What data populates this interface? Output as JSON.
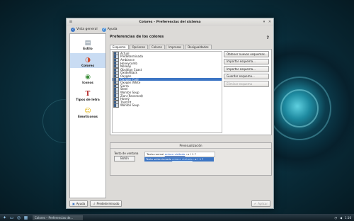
{
  "window": {
    "title": "Colores – Preferencias del sistema",
    "menu_icon": "☰",
    "min_icon": "▾",
    "close_icon": "✕"
  },
  "toolbar": {
    "overview_label": "Vista general",
    "help_label": "Ayuda"
  },
  "sidebar": {
    "items": [
      {
        "label": "Estilo",
        "icon": "style-icon",
        "glyph": "▤"
      },
      {
        "label": "Colores",
        "icon": "colors-icon",
        "glyph": "◑"
      },
      {
        "label": "Iconos",
        "icon": "icons-icon",
        "glyph": "◉"
      },
      {
        "label": "Tipos de letra",
        "icon": "fonts-icon",
        "glyph": "T"
      },
      {
        "label": "Emoticonos",
        "icon": "emoticons-icon",
        "glyph": "☺"
      }
    ]
  },
  "main": {
    "title": "Preferencias de los colores",
    "help_icon": "?",
    "tabs": [
      "Esquema",
      "Opciones",
      "Colores",
      "Impresos",
      "Desigualdades"
    ],
    "schemes": [
      "Actual",
      "Predeterminada",
      "Ambiance",
      "Honeycomb",
      "Norway",
      "Obsidian Coast",
      "Oxide/Black",
      "Oxygen",
      "Oxygen Cold",
      "Oxygen White",
      "Sierra",
      "Steel",
      "Wonton Soup",
      "Zion (Reversed)",
      "Honey",
      "Thatcht",
      "Wonton Soup"
    ],
    "selected_index": 8,
    "actions": [
      {
        "label": "Obtener nuevos esquemas...",
        "enabled": true
      },
      {
        "label": "Importar esquema...",
        "enabled": true
      },
      {
        "label": "Importar esquema...",
        "enabled": true
      },
      {
        "label": "Guardar esquema...",
        "enabled": true
      },
      {
        "label": "Eliminar esquema",
        "enabled": false
      }
    ]
  },
  "preview": {
    "title": "Previsualización",
    "window_text_label": "Texto de ventana",
    "button_label": "Botón",
    "normal_text": "Texto normal",
    "normal_link": "enlace visitado",
    "selected_text": "Texto seleccionado",
    "selected_link": "enlace visitado",
    "symbols": "‹ ▸ ! 1 ?"
  },
  "footer": {
    "help_label": "Ayuda",
    "defaults_label": "Predeterminado",
    "apply_label": "Aplicar"
  },
  "taskbar": {
    "task_label": "Colores – Preferencias de...",
    "clock": "1:16"
  }
}
